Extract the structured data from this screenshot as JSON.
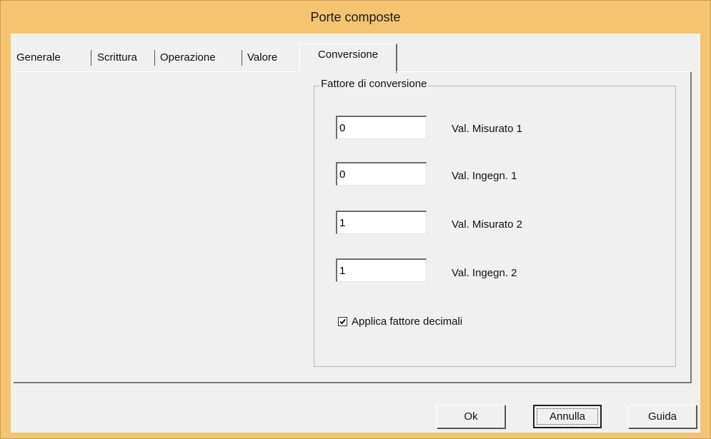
{
  "window": {
    "title": "Porte composte"
  },
  "tabs": [
    {
      "label": "Generale"
    },
    {
      "label": "Scrittura"
    },
    {
      "label": "Operazione"
    },
    {
      "label": "Valore"
    },
    {
      "label": "Conversione",
      "active": true
    }
  ],
  "conversion": {
    "group_label": "Fattore di conversione",
    "fields": [
      {
        "label": "Val. Misurato 1",
        "value": "0"
      },
      {
        "label": "Val. Ingegn. 1",
        "value": "0"
      },
      {
        "label": "Val. Misurato 2",
        "value": "1"
      },
      {
        "label": "Val. Ingegn. 2",
        "value": "1"
      }
    ],
    "checkbox": {
      "label": "Applica fattore decimali",
      "checked": true
    }
  },
  "buttons": {
    "ok": "Ok",
    "cancel": "Annulla",
    "help": "Guida"
  },
  "colors": {
    "titlebar": "#f4c470",
    "background": "#f0f0f0"
  }
}
